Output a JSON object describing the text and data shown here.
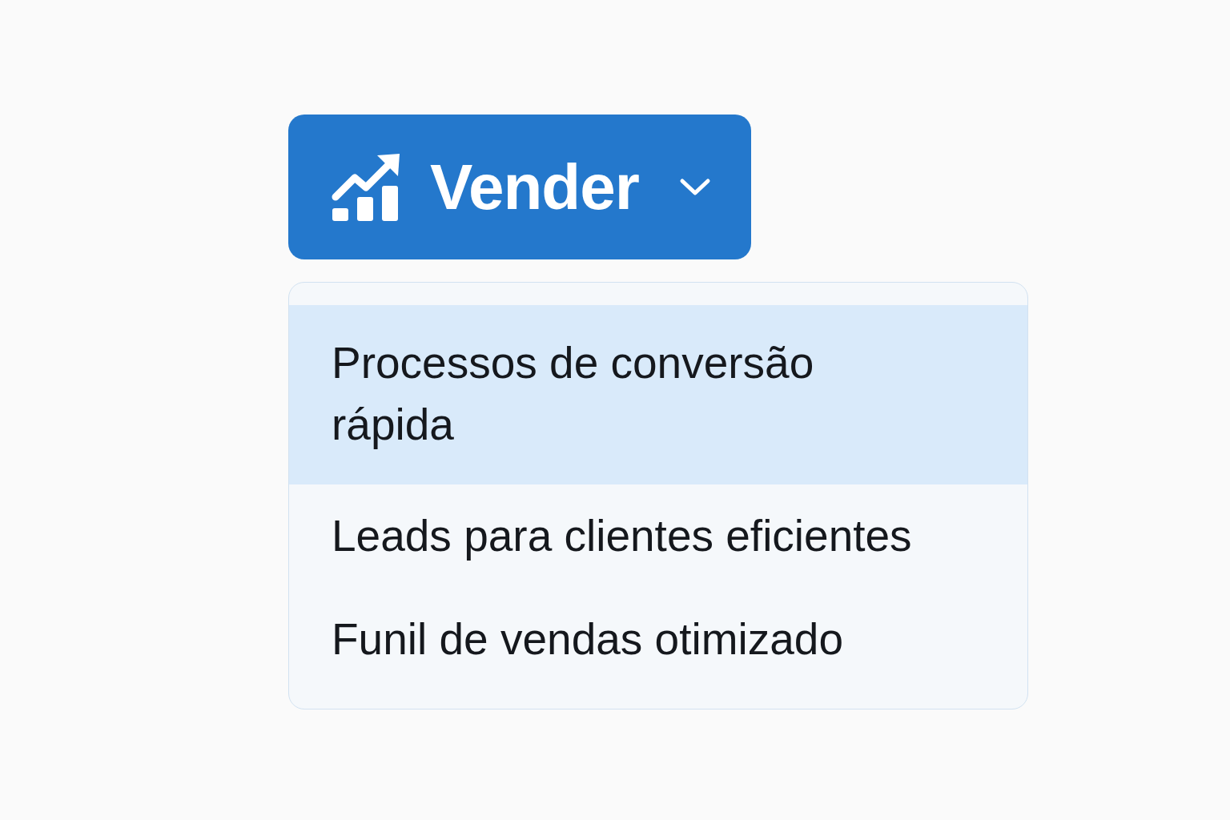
{
  "menu_button": {
    "label": "Vender",
    "expanded": true
  },
  "menu_items": [
    {
      "label": "Processos de conversão rápida",
      "selected": true
    },
    {
      "label": "Leads para clientes eficientes",
      "selected": false
    },
    {
      "label": "Funil de vendas otimizado",
      "selected": false
    }
  ]
}
